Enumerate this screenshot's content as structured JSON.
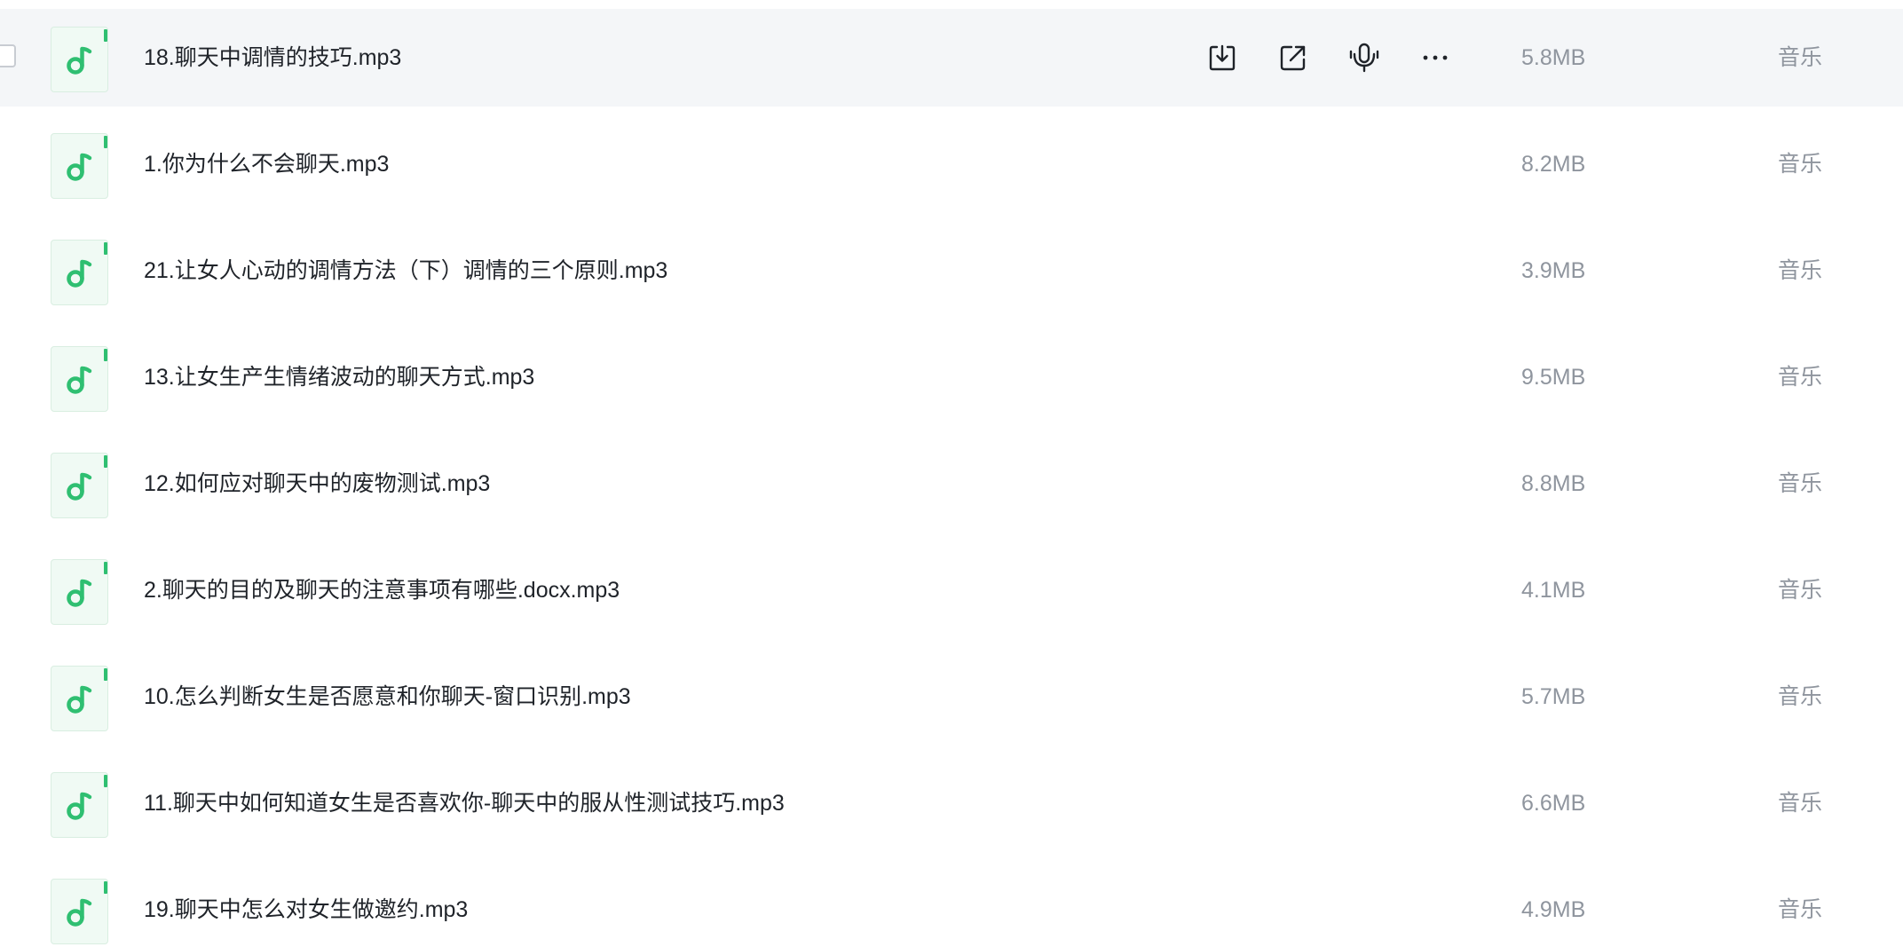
{
  "files": [
    {
      "name": "18.聊天中调情的技巧.mp3",
      "size": "5.8MB",
      "type": "音乐",
      "hovered": true
    },
    {
      "name": "1.你为什么不会聊天.mp3",
      "size": "8.2MB",
      "type": "音乐"
    },
    {
      "name": "21.让女人心动的调情方法（下）调情的三个原则.mp3",
      "size": "3.9MB",
      "type": "音乐"
    },
    {
      "name": "13.让女生产生情绪波动的聊天方式.mp3",
      "size": "9.5MB",
      "type": "音乐"
    },
    {
      "name": "12.如何应对聊天中的废物测试.mp3",
      "size": "8.8MB",
      "type": "音乐"
    },
    {
      "name": "2.聊天的目的及聊天的注意事项有哪些.docx.mp3",
      "size": "4.1MB",
      "type": "音乐"
    },
    {
      "name": "10.怎么判断女生是否愿意和你聊天-窗口识别.mp3",
      "size": "5.7MB",
      "type": "音乐"
    },
    {
      "name": "11.聊天中如何知道女生是否喜欢你-聊天中的服从性测试技巧.mp3",
      "size": "6.6MB",
      "type": "音乐"
    },
    {
      "name": "19.聊天中怎么对女生做邀约.mp3",
      "size": "4.9MB",
      "type": "音乐"
    }
  ],
  "row_actions": [
    {
      "icon": "download-icon"
    },
    {
      "icon": "share-icon"
    },
    {
      "icon": "microphone-icon"
    },
    {
      "icon": "more-icon"
    }
  ],
  "colors": {
    "accent_green": "#2fbf71",
    "hover_row": "#f4f6f8",
    "text_primary": "#1f2329",
    "text_secondary": "#8f959e"
  }
}
